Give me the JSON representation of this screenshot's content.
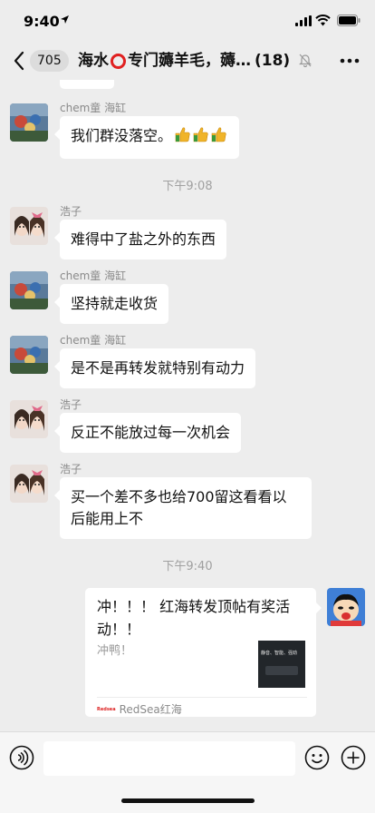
{
  "status_bar": {
    "time": "9:40"
  },
  "header": {
    "back_count": "705",
    "title_prefix": "海水",
    "title_suffix": "专门薅羊毛，薅…",
    "member_count": "(18)"
  },
  "messages": [
    {
      "sender": "chem童 海缸",
      "text": "我们群没落空。"
    },
    {
      "sender": "浩子",
      "text": "难得中了盐之外的东西"
    },
    {
      "sender": "chem童 海缸",
      "text": "坚持就走收货"
    },
    {
      "sender": "chem童 海缸",
      "text": "是不是再转发就特别有动力"
    },
    {
      "sender": "浩子",
      "text": "反正不能放过每一次机会"
    },
    {
      "sender": "浩子",
      "text": "买一个差不多也给700留这看看以后能用上不"
    }
  ],
  "time_dividers": [
    "下午9:08",
    "下午9:40"
  ],
  "link_card": {
    "title": "冲！！！ 红海转发顶帖有奖活动！！",
    "description": "冲鸭！",
    "thumb_text": "静音、智能、强劲",
    "source_logo": "Redsea",
    "source": "RedSea红海"
  },
  "input": {
    "placeholder": ""
  },
  "colors": {
    "background": "#ededed",
    "bubble": "#ffffff",
    "title_circle": "#e02020"
  }
}
